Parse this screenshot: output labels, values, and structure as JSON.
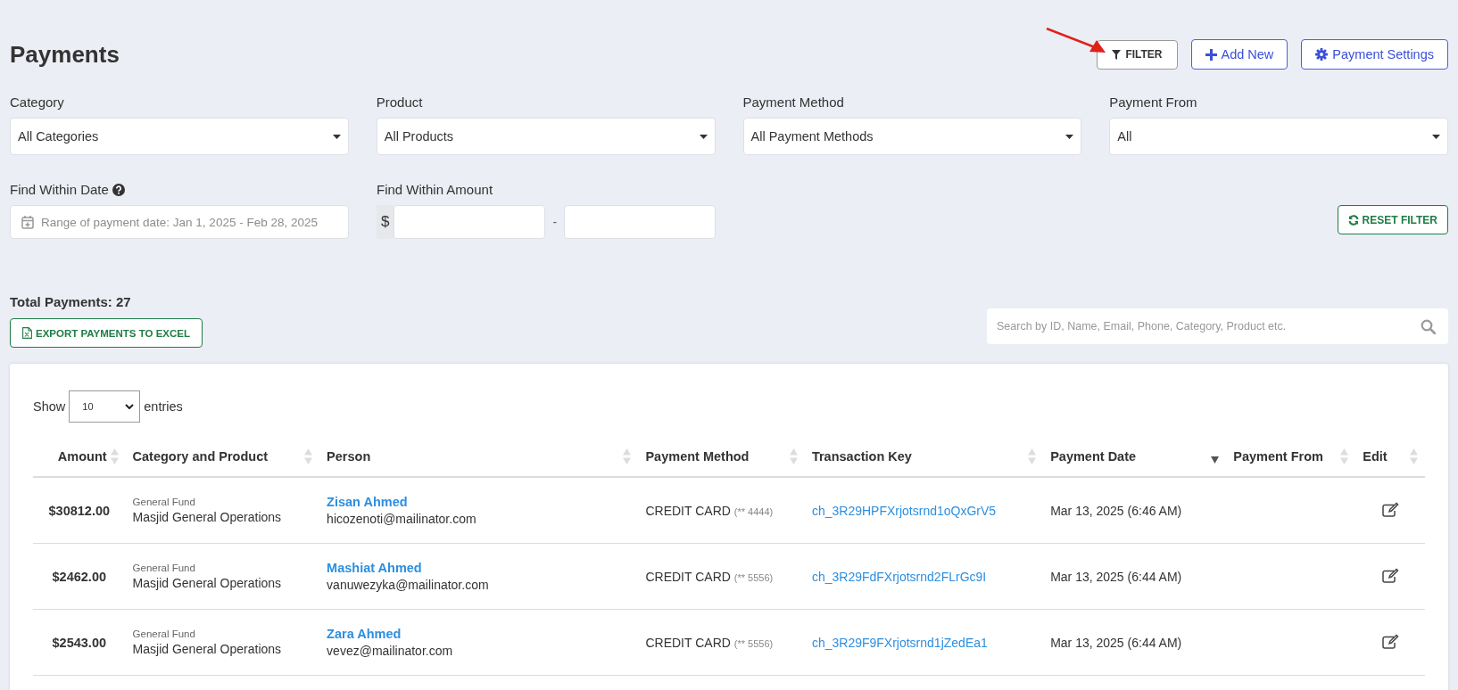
{
  "title": "Payments",
  "header_buttons": [
    {
      "kind": "filter",
      "label": "FILTER"
    },
    {
      "kind": "add",
      "label": "Add New"
    },
    {
      "kind": "settings",
      "label": "Payment Settings"
    }
  ],
  "filters": [
    {
      "label": "Category",
      "value": "All Categories"
    },
    {
      "label": "Product",
      "value": "All Products"
    },
    {
      "label": "Payment Method",
      "value": "All Payment Methods"
    },
    {
      "label": "Payment From",
      "value": "All"
    }
  ],
  "date_filter": {
    "label": "Find Within Date",
    "placeholder": "Range of payment date: Jan 1, 2025 - Feb 28, 2025"
  },
  "amount_filter": {
    "label": "Find Within Amount",
    "currency": "$",
    "separator": "-"
  },
  "reset_button": "RESET FILTER",
  "total": "Total Payments: 27",
  "export_button": "EXPORT PAYMENTS TO EXCEL",
  "search": {
    "placeholder": "Search by ID, Name, Email, Phone, Category, Product etc."
  },
  "table": {
    "show_label": "Show",
    "page_size": "10",
    "entries_label": "entries",
    "columns": [
      {
        "label": "Amount",
        "sorted": false
      },
      {
        "label": "Category and Product",
        "sorted": false
      },
      {
        "label": "Person",
        "sorted": false
      },
      {
        "label": "Payment Method",
        "sorted": false
      },
      {
        "label": "Transaction Key",
        "sorted": false
      },
      {
        "label": "Payment Date",
        "sorted": true
      },
      {
        "label": "Payment From",
        "sorted": false
      },
      {
        "label": "Edit",
        "sorted": false
      }
    ],
    "rows": [
      {
        "amount": "$30812.00",
        "category": "General Fund",
        "product": "Masjid General Operations",
        "name": "Zisan Ahmed",
        "email": "hicozenoti@mailinator.com",
        "method": "CREDIT CARD",
        "card": "(** 4444)",
        "transaction_key": "ch_3R29HPFXrjotsrnd1oQxGrV5",
        "date": "Mar 13, 2025 (6:46 AM)"
      },
      {
        "amount": "$2462.00",
        "category": "General Fund",
        "product": "Masjid General Operations",
        "name": "Mashiat Ahmed",
        "email": "vanuwezyka@mailinator.com",
        "method": "CREDIT CARD",
        "card": "(** 5556)",
        "transaction_key": "ch_3R29FdFXrjotsrnd2FLrGc9I",
        "date": "Mar 13, 2025 (6:44 AM)"
      },
      {
        "amount": "$2543.00",
        "category": "General Fund",
        "product": "Masjid General Operations",
        "name": "Zara Ahmed",
        "email": "vevez@mailinator.com",
        "method": "CREDIT CARD",
        "card": "(** 5556)",
        "transaction_key": "ch_3R29F9FXrjotsrnd1jZedEa1",
        "date": "Mar 13, 2025 (6:44 AM)"
      }
    ]
  }
}
